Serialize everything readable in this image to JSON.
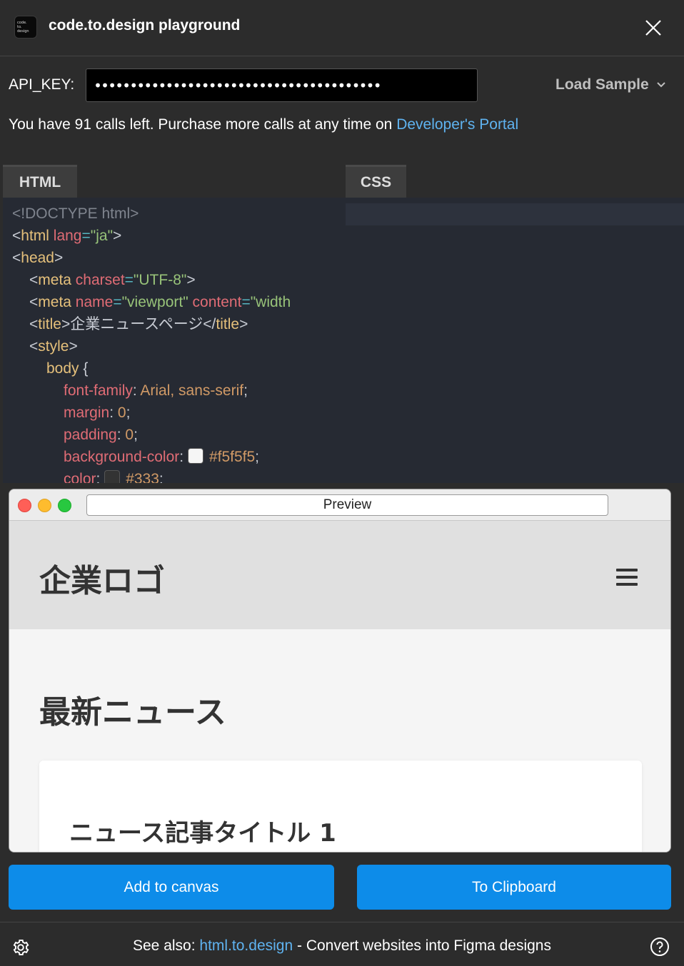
{
  "header": {
    "logo_lines": [
      "code.",
      "to.",
      "design"
    ],
    "title": "code.to.design playground"
  },
  "api": {
    "label": "API_KEY:",
    "value": "••••••••••••••••••••••••••••••••••••••••",
    "load_sample": "Load Sample"
  },
  "calls": {
    "text": "You have 91 calls left. Purchase more calls at any time on ",
    "link": "Developer's Portal"
  },
  "tabs": {
    "html": "HTML",
    "css": "CSS"
  },
  "code": {
    "l1": "<!DOCTYPE html>",
    "l2_open": "<",
    "l2_tag": "html",
    "l2_attr": " lang",
    "l2_eq": "=",
    "l2_val": "\"ja\"",
    "l2_close": ">",
    "l3_open": "<",
    "l3_tag": "head",
    "l3_close": ">",
    "l4_open": "<",
    "l4_tag": "meta",
    "l4_attr": " charset",
    "l4_eq": "=",
    "l4_val": "\"UTF-8\"",
    "l4_close": ">",
    "l5_open": "<",
    "l5_tag": "meta",
    "l5_attr1": " name",
    "l5_eq1": "=",
    "l5_val1": "\"viewport\"",
    "l5_attr2": " content",
    "l5_eq2": "=",
    "l5_val2": "\"width",
    "l6_open": "<",
    "l6_tag": "title",
    "l6_close": ">",
    "l6_text": "企業ニュースページ",
    "l6_end": "</",
    "l6_tag2": "title",
    "l6_close2": ">",
    "l7_open": "<",
    "l7_tag": "style",
    "l7_close": ">",
    "l8_sel": "body",
    "l8_brace": " {",
    "l9_prop": "font-family",
    "l9_colon": ": ",
    "l9_val": "Arial, sans-serif",
    "l9_semi": ";",
    "l10_prop": "margin",
    "l10_colon": ": ",
    "l10_val": "0",
    "l10_semi": ";",
    "l11_prop": "padding",
    "l11_colon": ": ",
    "l11_val": "0",
    "l11_semi": ";",
    "l12_prop": "background-color",
    "l12_colon": ": ",
    "l12_val": "#f5f5f5",
    "l12_semi": ";",
    "l13_prop": "color",
    "l13_colon": ": ",
    "l13_val": "#333",
    "l13_semi": ";"
  },
  "colors": {
    "bg_swatch": "#f5f5f5",
    "text_swatch": "#333333",
    "accent": "#0d8ce9",
    "link": "#5fb3f0"
  },
  "preview": {
    "url": "Preview",
    "site_logo": "企業ロゴ",
    "news_heading": "最新ニュース",
    "article_title": "ニュース記事タイトル 1"
  },
  "buttons": {
    "add": "Add to canvas",
    "clipboard": "To Clipboard"
  },
  "footer": {
    "prefix": "See also: ",
    "link": "html.to.design",
    "suffix": " - Convert websites into Figma designs"
  },
  "icons": {
    "close": "close-icon",
    "chevron": "chevron-down-icon",
    "gear": "gear-icon",
    "help": "help-icon",
    "menu": "hamburger-icon"
  }
}
